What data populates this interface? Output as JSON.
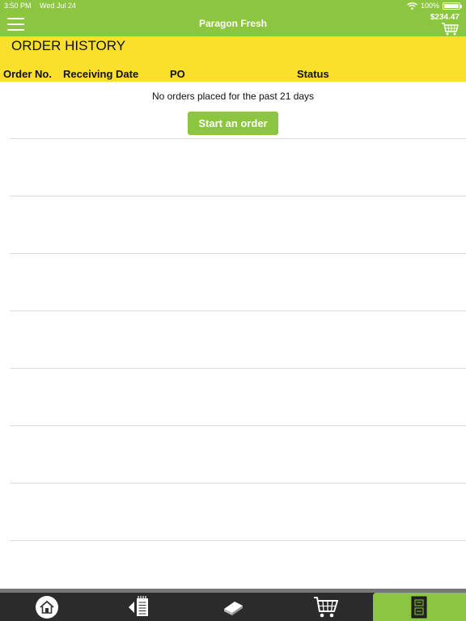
{
  "status_bar": {
    "time": "3:50 PM",
    "date": "Wed Jul 24",
    "battery": "100%"
  },
  "header": {
    "title": "Paragon Fresh",
    "cart_total": "$234.47",
    "menu_icon": "hamburger-menu-icon",
    "cart_icon": "cart-icon"
  },
  "page": {
    "title": "ORDER HISTORY"
  },
  "table": {
    "columns": [
      "Order No.",
      "Receiving Date",
      "PO",
      "Status"
    ],
    "rows": []
  },
  "empty": {
    "message": "No orders placed for the past 21 days",
    "button": "Start an order"
  },
  "tabs": [
    {
      "icon": "home-icon",
      "active": false
    },
    {
      "icon": "order-list-icon",
      "active": false
    },
    {
      "icon": "catalog-book-icon",
      "active": false
    },
    {
      "icon": "cart-icon",
      "active": false
    },
    {
      "icon": "order-history-icon",
      "active": true
    }
  ],
  "colors": {
    "brand_green": "#8cc540",
    "band_yellow": "#fbe02b",
    "tabbar": "#2b2b2b"
  }
}
